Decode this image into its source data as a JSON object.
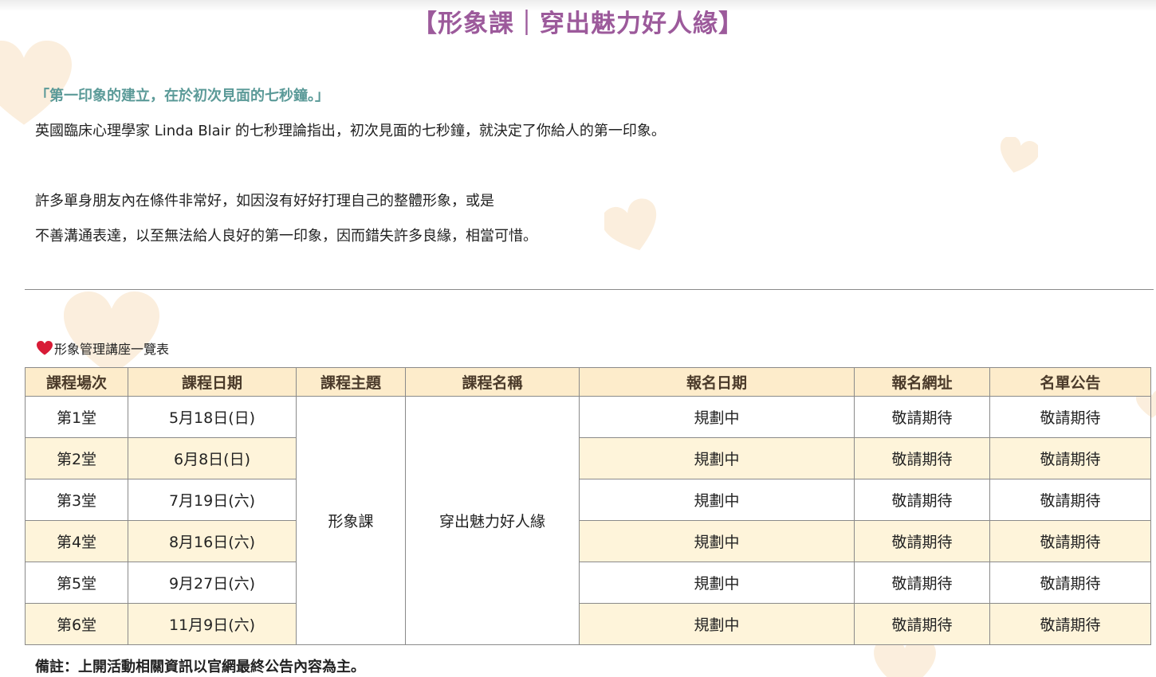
{
  "page": {
    "title": "【形象課｜穿出魅力好人緣】",
    "quote": "「第一印象的建立，在於初次見面的七秒鐘。」",
    "paragraph1": "英國臨床心理學家 Linda Blair 的七秒理論指出，初次見面的七秒鐘，就決定了你給人的第一印象。",
    "paragraph2_line1": "許多單身朋友內在條件非常好，如因沒有好好打理自己的整體形象，或是",
    "paragraph2_line2": "不善溝通表達，以至無法給人良好的第一印象，因而錯失許多良緣，相當可惜。"
  },
  "section": {
    "label": "形象管理講座一覽表",
    "icon": "heart-icon",
    "icon_color": "#d81b36"
  },
  "table": {
    "headers": [
      "課程場次",
      "課程日期",
      "課程主題",
      "課程名稱",
      "報名日期",
      "報名網址",
      "名單公告"
    ],
    "topic": "形象課",
    "course_name": "穿出魅力好人緣",
    "rows": [
      {
        "session": "第1堂",
        "date": "5月18日(日)",
        "signup_date": "規劃中",
        "signup_url": "敬請期待",
        "announcement": "敬請期待"
      },
      {
        "session": "第2堂",
        "date": "6月8日(日)",
        "signup_date": "規劃中",
        "signup_url": "敬請期待",
        "announcement": "敬請期待"
      },
      {
        "session": "第3堂",
        "date": "7月19日(六)",
        "signup_date": "規劃中",
        "signup_url": "敬請期待",
        "announcement": "敬請期待"
      },
      {
        "session": "第4堂",
        "date": "8月16日(六)",
        "signup_date": "規劃中",
        "signup_url": "敬請期待",
        "announcement": "敬請期待"
      },
      {
        "session": "第5堂",
        "date": "9月27日(六)",
        "signup_date": "規劃中",
        "signup_url": "敬請期待",
        "announcement": "敬請期待"
      },
      {
        "session": "第6堂",
        "date": "11月9日(六)",
        "signup_date": "規劃中",
        "signup_url": "敬請期待",
        "announcement": "敬請期待"
      }
    ]
  },
  "note": "備註：上開活動相關資訊以官網最終公告內容為主。",
  "colors": {
    "title": "#9c5a9b",
    "quote": "#5b9a98",
    "header_bg": "#fdeccb",
    "alt_row_bg": "#fef4da",
    "decor_heart": "#fbeedd"
  }
}
